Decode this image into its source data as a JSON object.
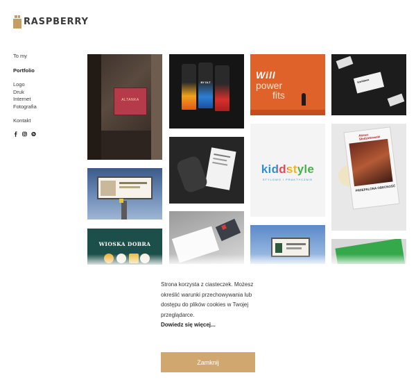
{
  "brand": {
    "name": "RASPBERRY",
    "accent": "#d0a86f"
  },
  "nav": {
    "items": [
      {
        "label": "To my"
      },
      {
        "label": "Portfolio",
        "active": true
      },
      {
        "label": "Logo"
      },
      {
        "label": "Druk"
      },
      {
        "label": "Internet"
      },
      {
        "label": "Fotografia"
      },
      {
        "label": "Kontakt"
      }
    ],
    "social_icons": [
      "facebook-icon",
      "instagram-icon",
      "behance-icon"
    ]
  },
  "portfolio": {
    "tiles": [
      {
        "art_text": "ALTANKA"
      },
      {
        "art_text": "BY DLT"
      },
      {
        "art_text_top": "Will",
        "art_text_line1": "power",
        "art_text_line2": "fits"
      },
      {
        "art_text": "Kwidawa"
      },
      {
        "art_text": ""
      },
      {
        "art_text": ""
      },
      {
        "art_text": "kiddstyle",
        "art_subtext": "STYLOWO I PRAKTYCZNIE"
      },
      {
        "art_text_head": "Akiozz Słodziekowski",
        "art_text": "PRZEPALONA OBECNOŚĆ"
      },
      {
        "art_text": "WIOSKA DOBRA"
      },
      {
        "art_text": ""
      },
      {
        "art_text": ""
      },
      {
        "art_text": ""
      }
    ]
  },
  "cookie": {
    "message": "Strona korzysta z ciasteczek. Możesz określić warunki przechowywania lub dostępu do plików cookies w Twojej przeglądarce.",
    "more_link": "Dowiedz się więcej...",
    "close_label": "Zamknij"
  }
}
